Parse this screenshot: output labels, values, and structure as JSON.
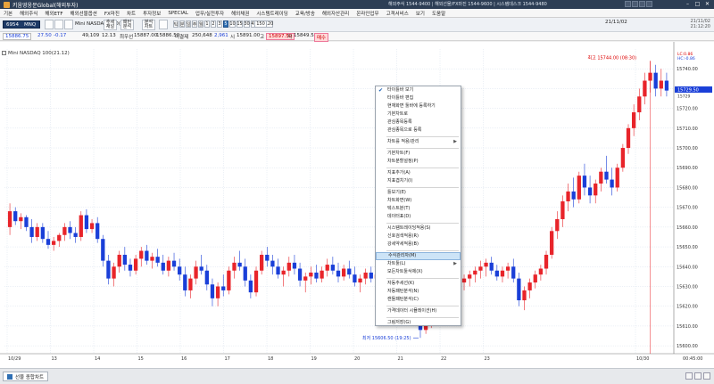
{
  "window": {
    "title": "키움영웅문Global(해외투자)",
    "contacts": "해외주식 1544-9400 | 해외선물/FX마진 1544-9600 | 시스템데스크 1544-9480"
  },
  "menu": [
    "기본",
    "해외주식",
    "해외ETF",
    "해외선물옵션",
    "FX마진",
    "차트",
    "투자정보",
    "SPECIAL",
    "업무/실전투자",
    "해외채권",
    "시스템트레이딩",
    "교육/방송",
    "해외자산관리",
    "온라인업무",
    "고객서비스",
    "보기",
    "도움말"
  ],
  "toolbar": {
    "account": "6954",
    "symbol": "MNQ",
    "instrument": "Mini NASDAQ 100(21.",
    "btn_trend": "추세\n채널",
    "btn_pattern": "패턴\n분석",
    "btn_analysis": "분석\n차트",
    "timeframes": [
      "틱",
      "분",
      "일",
      "주",
      "월",
      "1",
      "2",
      "3",
      "5",
      "10",
      "15",
      "30",
      "45",
      "60",
      "120"
    ],
    "selected_timeframe": "5",
    "count": "150",
    "date_value": "21/11/02",
    "clock_top": "21/11/02",
    "clock_bottom": "21:12:20"
  },
  "quote": {
    "price": "15886.75",
    "change": "27.50",
    "change_pct": "-0.17",
    "volume": "49,109",
    "volume_pct": "12.13",
    "prev_close_label": "최우선",
    "prev_close": "15887.00",
    "ask": "15886.50",
    "ask_label": "미결제",
    "open_interest": "250,648",
    "oi_change": "2,961",
    "high_label": "시",
    "high": "15891.00",
    "low_label": "고",
    "low": "15897.50",
    "last_label": "저",
    "last": "15849.50",
    "order_button": "매수"
  },
  "chart": {
    "label": "Mini NASDAQ 100(21.12)",
    "max_label": "최고 15744.00 (08:30)",
    "min_label": "최저 15606.50 (19:25)",
    "lc_label": "LC:0.86",
    "hc_label": "HC:-0.86",
    "current_price": "15729.50",
    "current_price2": "15729",
    "y_ticks": [
      "15740.00",
      "15730.00",
      "15720.00",
      "15710.00",
      "15700.00",
      "15690.00",
      "15680.00",
      "15670.00",
      "15660.00",
      "15650.00",
      "15640.00",
      "15630.00",
      "15620.00",
      "15610.00",
      "15600.00"
    ],
    "x_ticks": [
      "10/29",
      "13",
      "14",
      "15",
      "16",
      "17",
      "18",
      "19",
      "20",
      "21",
      "22",
      "23",
      "10/30",
      "00:45:00"
    ]
  },
  "context_menu": [
    {
      "type": "item",
      "label": "타이틀바 보기",
      "checked": true
    },
    {
      "type": "item",
      "label": "타이틀바 편집"
    },
    {
      "type": "item",
      "label": "현재화면 툴바에 등록하기"
    },
    {
      "type": "item",
      "label": "기본차트로"
    },
    {
      "type": "item",
      "label": "관심종목등록"
    },
    {
      "type": "item",
      "label": "관심종목으로 등록"
    },
    {
      "type": "sep"
    },
    {
      "type": "item",
      "label": "차트를 적용/관리",
      "submenu": true
    },
    {
      "type": "sep"
    },
    {
      "type": "item",
      "label": "기본차트(F)"
    },
    {
      "type": "item",
      "label": "차트분할설정(P)"
    },
    {
      "type": "sep"
    },
    {
      "type": "item",
      "label": "지표추가(A)"
    },
    {
      "type": "item",
      "label": "지표겹치기(I)"
    },
    {
      "type": "sep"
    },
    {
      "type": "item",
      "label": "틀보기(E)"
    },
    {
      "type": "item",
      "label": "차트화면(W)"
    },
    {
      "type": "item",
      "label": "텍스트분(T)"
    },
    {
      "type": "item",
      "label": "데이터표(D)"
    },
    {
      "type": "sep"
    },
    {
      "type": "item",
      "label": "시스템트레이딩적용(S)"
    },
    {
      "type": "item",
      "label": "신호검색적용(R)"
    },
    {
      "type": "item",
      "label": "강세약세적용(B)"
    },
    {
      "type": "sep"
    },
    {
      "type": "item",
      "label": "수식관리자(M)",
      "highlight": true
    },
    {
      "type": "item",
      "label": "차트툴(L)",
      "submenu": true
    },
    {
      "type": "item",
      "label": "모든차트툴삭제(X)"
    },
    {
      "type": "sep"
    },
    {
      "type": "item",
      "label": "자동추세선(K)"
    },
    {
      "type": "item",
      "label": "자동패턴분석(N)"
    },
    {
      "type": "item",
      "label": "캔들패턴분석(C)"
    },
    {
      "type": "sep"
    },
    {
      "type": "item",
      "label": "가격데이터 시뮬레이션(H)"
    },
    {
      "type": "sep"
    },
    {
      "type": "item",
      "label": "그림저장(G)"
    }
  ],
  "status": {
    "tab_label": "선물 종합차트"
  },
  "chart_data": {
    "type": "candlestick",
    "ylim": [
      15596,
      15750
    ],
    "candles": [
      [
        15660,
        15672,
        15656,
        15668
      ],
      [
        15668,
        15670,
        15661,
        15663
      ],
      [
        15663,
        15667,
        15659,
        15665
      ],
      [
        15665,
        15666,
        15658,
        15660
      ],
      [
        15660,
        15664,
        15652,
        15655
      ],
      [
        15655,
        15662,
        15653,
        15660
      ],
      [
        15660,
        15662,
        15652,
        15654
      ],
      [
        15654,
        15658,
        15649,
        15651
      ],
      [
        15651,
        15655,
        15648,
        15653
      ],
      [
        15653,
        15657,
        15650,
        15656
      ],
      [
        15656,
        15662,
        15653,
        15660
      ],
      [
        15660,
        15663,
        15654,
        15657
      ],
      [
        15657,
        15660,
        15652,
        15655
      ],
      [
        15655,
        15668,
        15653,
        15666
      ],
      [
        15666,
        15669,
        15657,
        15659
      ],
      [
        15659,
        15664,
        15657,
        15662
      ],
      [
        15662,
        15665,
        15652,
        15654
      ],
      [
        15654,
        15656,
        15640,
        15643
      ],
      [
        15643,
        15646,
        15631,
        15634
      ],
      [
        15634,
        15642,
        15630,
        15640
      ],
      [
        15640,
        15648,
        15637,
        15646
      ],
      [
        15646,
        15650,
        15638,
        15641
      ],
      [
        15641,
        15644,
        15635,
        15638
      ],
      [
        15638,
        15646,
        15636,
        15644
      ],
      [
        15644,
        15650,
        15640,
        15648
      ],
      [
        15648,
        15651,
        15641,
        15643
      ],
      [
        15643,
        15647,
        15639,
        15645
      ],
      [
        15645,
        15649,
        15640,
        15642
      ],
      [
        15642,
        15646,
        15636,
        15638
      ],
      [
        15638,
        15645,
        15635,
        15643
      ],
      [
        15643,
        15647,
        15638,
        15640
      ],
      [
        15640,
        15644,
        15633,
        15636
      ],
      [
        15636,
        15640,
        15625,
        15628
      ],
      [
        15628,
        15636,
        15624,
        15634
      ],
      [
        15634,
        15643,
        15631,
        15640
      ],
      [
        15640,
        15646,
        15636,
        15638
      ],
      [
        15638,
        15641,
        15628,
        15631
      ],
      [
        15631,
        15634,
        15620,
        15624
      ],
      [
        15624,
        15632,
        15620,
        15630
      ],
      [
        15630,
        15636,
        15625,
        15628
      ],
      [
        15628,
        15640,
        15626,
        15638
      ],
      [
        15638,
        15645,
        15634,
        15642
      ],
      [
        15642,
        15648,
        15638,
        15640
      ],
      [
        15640,
        15644,
        15630,
        15633
      ],
      [
        15633,
        15636,
        15624,
        15627
      ],
      [
        15627,
        15640,
        15625,
        15638
      ],
      [
        15638,
        15648,
        15636,
        15646
      ],
      [
        15646,
        15650,
        15640,
        15643
      ],
      [
        15643,
        15646,
        15636,
        15640
      ],
      [
        15640,
        15644,
        15634,
        15636
      ],
      [
        15636,
        15640,
        15630,
        15638
      ],
      [
        15638,
        15645,
        15635,
        15642
      ],
      [
        15642,
        15646,
        15636,
        15639
      ],
      [
        15639,
        15642,
        15630,
        15633
      ],
      [
        15633,
        15637,
        15627,
        15635
      ],
      [
        15635,
        15640,
        15631,
        15637
      ],
      [
        15637,
        15641,
        15632,
        15634
      ],
      [
        15634,
        15640,
        15632,
        15638
      ],
      [
        15638,
        15644,
        15635,
        15641
      ],
      [
        15641,
        15645,
        15636,
        15638
      ],
      [
        15638,
        15642,
        15632,
        15635
      ],
      [
        15635,
        15641,
        15633,
        15639
      ],
      [
        15639,
        15643,
        15634,
        15636
      ],
      [
        15636,
        15640,
        15630,
        15632
      ],
      [
        15632,
        15636,
        15627,
        15634
      ],
      [
        15634,
        15639,
        15631,
        15637
      ],
      [
        15637,
        15640,
        15632,
        15634
      ],
      [
        15634,
        15638,
        15630,
        15636
      ],
      [
        15636,
        15640,
        15633,
        15638
      ],
      [
        15638,
        15641,
        15633,
        15635
      ],
      [
        15635,
        15639,
        15629,
        15631
      ],
      [
        15631,
        15636,
        15628,
        15634
      ],
      [
        15634,
        15637,
        15629,
        15631
      ],
      [
        15631,
        15634,
        15620,
        15622
      ],
      [
        15622,
        15626,
        15610,
        15613
      ],
      [
        15613,
        15617,
        15604,
        15608
      ],
      [
        15608,
        15614,
        15606,
        15611
      ],
      [
        15611,
        15625,
        15609,
        15622
      ],
      [
        15622,
        15630,
        15618,
        15627
      ],
      [
        15627,
        15634,
        15624,
        15631
      ],
      [
        15631,
        15636,
        15626,
        15628
      ],
      [
        15628,
        15633,
        15624,
        15630
      ],
      [
        15630,
        15634,
        15625,
        15632
      ],
      [
        15632,
        15636,
        15628,
        15634
      ],
      [
        15634,
        15638,
        15630,
        15636
      ],
      [
        15636,
        15640,
        15632,
        15638
      ],
      [
        15638,
        15643,
        15634,
        15640
      ],
      [
        15640,
        15644,
        15635,
        15642
      ],
      [
        15642,
        15645,
        15636,
        15638
      ],
      [
        15638,
        15641,
        15633,
        15635
      ],
      [
        15635,
        15640,
        15632,
        15638
      ],
      [
        15638,
        15642,
        15634,
        15640
      ],
      [
        15640,
        15644,
        15632,
        15634
      ],
      [
        15634,
        15637,
        15620,
        15623
      ],
      [
        15623,
        15630,
        15618,
        15628
      ],
      [
        15628,
        15634,
        15624,
        15632
      ],
      [
        15632,
        15638,
        15629,
        15636
      ],
      [
        15636,
        15641,
        15633,
        15639
      ],
      [
        15639,
        15648,
        15636,
        15646
      ],
      [
        15646,
        15660,
        15644,
        15658
      ],
      [
        15658,
        15668,
        15654,
        15664
      ],
      [
        15664,
        15676,
        15660,
        15673
      ],
      [
        15673,
        15682,
        15668,
        15678
      ],
      [
        15678,
        15685,
        15670,
        15674
      ],
      [
        15674,
        15688,
        15672,
        15686
      ],
      [
        15686,
        15692,
        15676,
        15680
      ],
      [
        15680,
        15686,
        15672,
        15676
      ],
      [
        15676,
        15684,
        15672,
        15682
      ],
      [
        15682,
        15690,
        15678,
        15688
      ],
      [
        15688,
        15696,
        15682,
        15684
      ],
      [
        15684,
        15690,
        15676,
        15680
      ],
      [
        15680,
        15692,
        15678,
        15690
      ],
      [
        15690,
        15702,
        15688,
        15700
      ],
      [
        15700,
        15712,
        15697,
        15710
      ],
      [
        15710,
        15722,
        15706,
        15718
      ],
      [
        15718,
        15730,
        15714,
        15726
      ],
      [
        15726,
        15738,
        15722,
        15734
      ],
      [
        15734,
        15744,
        15728,
        15738
      ],
      [
        15738,
        15742,
        15726,
        15730
      ],
      [
        15730,
        15740,
        15726,
        15734
      ],
      [
        15734,
        15738,
        15726,
        15729
      ]
    ]
  }
}
